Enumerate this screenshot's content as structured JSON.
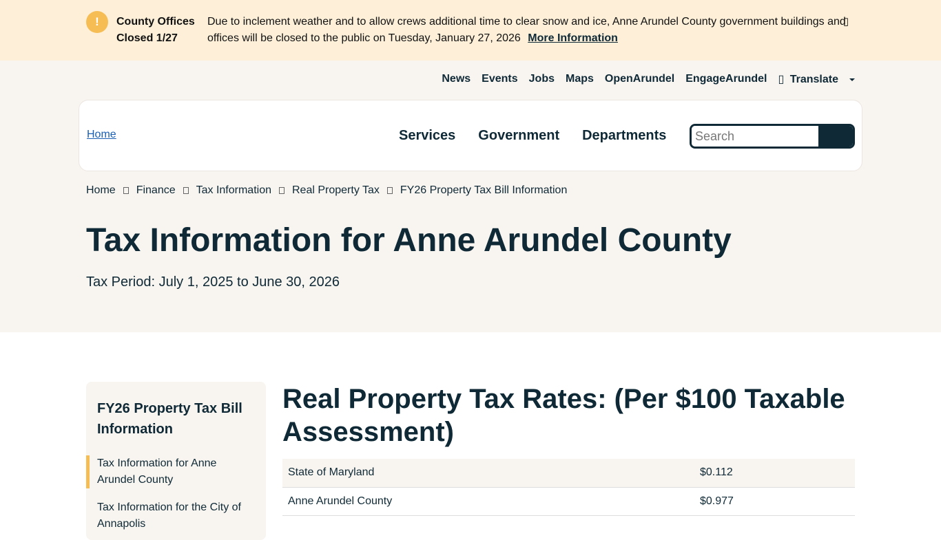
{
  "alert": {
    "icon": "exclamation-icon",
    "icon_glyph": "!",
    "title": "County Offices Closed 1/27",
    "message": "Due to inclement weather and to allow crews additional time to clear snow and ice, Anne Arundel County government buildings and offices will be closed to the public on Tuesday, January 27, 2026",
    "link": "More Information",
    "close_glyph": "▯"
  },
  "utility_nav": {
    "items": [
      "News",
      "Events",
      "Jobs",
      "Maps",
      "OpenArundel",
      "EngageArundel"
    ],
    "translate_glyph": "▯",
    "translate": "Translate"
  },
  "header": {
    "logo_alt": "Home",
    "nav": [
      "Services",
      "Government",
      "Departments"
    ],
    "search_placeholder": "Search"
  },
  "breadcrumb": [
    "Home",
    "Finance",
    "Tax Information",
    "Real Property Tax",
    "FY26 Property Tax Bill Information"
  ],
  "page": {
    "title": "Tax Information for Anne Arundel County",
    "subtitle": "Tax Period: July 1, 2025 to June 30, 2026"
  },
  "sidebar": {
    "heading": "FY26 Property Tax Bill Information",
    "items": [
      "Tax Information for Anne Arundel County",
      "Tax Information for the City of Annapolis"
    ]
  },
  "content": {
    "heading": "Real Property Tax Rates: (Per $100 Taxable Assessment)",
    "rows": [
      {
        "label": "State of Maryland",
        "value": "$0.112"
      },
      {
        "label": "Anne Arundel County",
        "value": "$0.977"
      }
    ]
  },
  "colors": {
    "alert_bg": "#fdefd8",
    "accent": "#f6bd54",
    "header_bg": "#f8f4f0",
    "navy": "#0f2a36"
  }
}
